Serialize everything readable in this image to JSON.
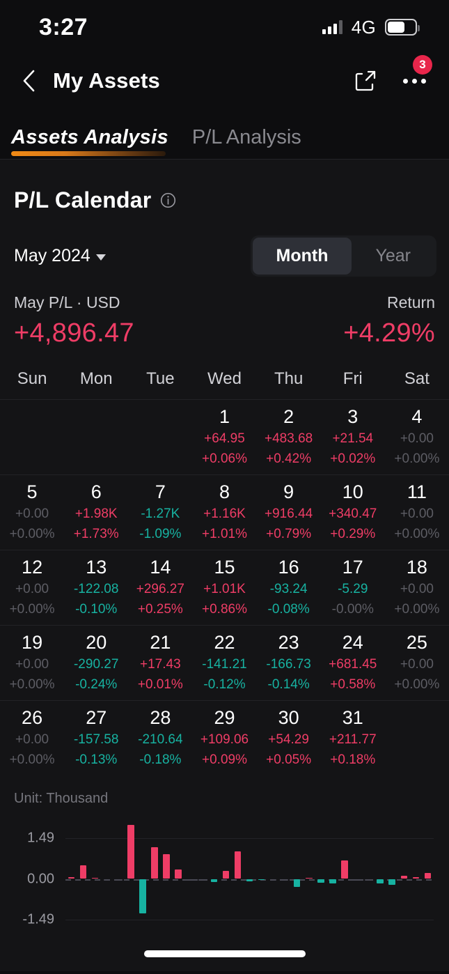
{
  "status_bar": {
    "time": "3:27",
    "network": "4G",
    "battery_level": 62,
    "signal_bars": 4
  },
  "nav": {
    "back_icon": "chevron-left-icon",
    "title": "My Assets",
    "share_icon": "share-external-icon",
    "more_icon": "more-dots-icon",
    "badge_count": "3"
  },
  "tabs": [
    {
      "label": "Assets Analysis",
      "active": true
    },
    {
      "label": "P/L Analysis",
      "active": false
    }
  ],
  "section": {
    "title": "P/L Calendar",
    "info_icon": "info-circle-icon",
    "month_selector": "May 2024",
    "caret_icon": "chevron-down-icon",
    "range_options": [
      {
        "label": "Month",
        "selected": true
      },
      {
        "label": "Year",
        "selected": false
      }
    ]
  },
  "summary": {
    "pl_label": "May P/L · USD",
    "pl_value": "+4,896.47",
    "return_label": "Return",
    "return_value": "+4.29%"
  },
  "colors": {
    "positive": "#ef3d66",
    "negative": "#17b2a1",
    "zero": "#5d5d64",
    "accent_tab": "#f08a16",
    "badge": "#e8264b"
  },
  "calendar": {
    "weekday_headers": [
      "Sun",
      "Mon",
      "Tue",
      "Wed",
      "Thu",
      "Fri",
      "Sat"
    ],
    "weeks": [
      [
        {
          "day": "",
          "amount": "",
          "percent": "",
          "state": "empty"
        },
        {
          "day": "",
          "amount": "",
          "percent": "",
          "state": "empty"
        },
        {
          "day": "",
          "amount": "",
          "percent": "",
          "state": "empty"
        },
        {
          "day": "1",
          "amount": "+64.95",
          "percent": "+0.06%",
          "state": "pos"
        },
        {
          "day": "2",
          "amount": "+483.68",
          "percent": "+0.42%",
          "state": "pos"
        },
        {
          "day": "3",
          "amount": "+21.54",
          "percent": "+0.02%",
          "state": "pos"
        },
        {
          "day": "4",
          "amount": "+0.00",
          "percent": "+0.00%",
          "state": "zero"
        }
      ],
      [
        {
          "day": "5",
          "amount": "+0.00",
          "percent": "+0.00%",
          "state": "zero"
        },
        {
          "day": "6",
          "amount": "+1.98K",
          "percent": "+1.73%",
          "state": "pos"
        },
        {
          "day": "7",
          "amount": "-1.27K",
          "percent": "-1.09%",
          "state": "neg"
        },
        {
          "day": "8",
          "amount": "+1.16K",
          "percent": "+1.01%",
          "state": "pos"
        },
        {
          "day": "9",
          "amount": "+916.44",
          "percent": "+0.79%",
          "state": "pos"
        },
        {
          "day": "10",
          "amount": "+340.47",
          "percent": "+0.29%",
          "state": "pos"
        },
        {
          "day": "11",
          "amount": "+0.00",
          "percent": "+0.00%",
          "state": "zero"
        }
      ],
      [
        {
          "day": "12",
          "amount": "+0.00",
          "percent": "+0.00%",
          "state": "zero"
        },
        {
          "day": "13",
          "amount": "-122.08",
          "percent": "-0.10%",
          "state": "neg"
        },
        {
          "day": "14",
          "amount": "+296.27",
          "percent": "+0.25%",
          "state": "pos"
        },
        {
          "day": "15",
          "amount": "+1.01K",
          "percent": "+0.86%",
          "state": "pos"
        },
        {
          "day": "16",
          "amount": "-93.24",
          "percent": "-0.08%",
          "state": "neg"
        },
        {
          "day": "17",
          "amount": "-5.29",
          "percent": "-0.00%",
          "state": "neg-zeropct"
        },
        {
          "day": "18",
          "amount": "+0.00",
          "percent": "+0.00%",
          "state": "zero"
        }
      ],
      [
        {
          "day": "19",
          "amount": "+0.00",
          "percent": "+0.00%",
          "state": "zero"
        },
        {
          "day": "20",
          "amount": "-290.27",
          "percent": "-0.24%",
          "state": "neg"
        },
        {
          "day": "21",
          "amount": "+17.43",
          "percent": "+0.01%",
          "state": "pos"
        },
        {
          "day": "22",
          "amount": "-141.21",
          "percent": "-0.12%",
          "state": "neg"
        },
        {
          "day": "23",
          "amount": "-166.73",
          "percent": "-0.14%",
          "state": "neg"
        },
        {
          "day": "24",
          "amount": "+681.45",
          "percent": "+0.58%",
          "state": "pos"
        },
        {
          "day": "25",
          "amount": "+0.00",
          "percent": "+0.00%",
          "state": "zero"
        }
      ],
      [
        {
          "day": "26",
          "amount": "+0.00",
          "percent": "+0.00%",
          "state": "zero"
        },
        {
          "day": "27",
          "amount": "-157.58",
          "percent": "-0.13%",
          "state": "neg"
        },
        {
          "day": "28",
          "amount": "-210.64",
          "percent": "-0.18%",
          "state": "neg"
        },
        {
          "day": "29",
          "amount": "+109.06",
          "percent": "+0.09%",
          "state": "pos"
        },
        {
          "day": "30",
          "amount": "+54.29",
          "percent": "+0.05%",
          "state": "pos"
        },
        {
          "day": "31",
          "amount": "+211.77",
          "percent": "+0.18%",
          "state": "pos"
        },
        {
          "day": "",
          "amount": "",
          "percent": "",
          "state": "empty"
        }
      ]
    ]
  },
  "chart_data": {
    "type": "bar",
    "unit_label": "Unit: Thousand",
    "title": "",
    "xlabel": "",
    "ylabel": "",
    "ylim": [
      -1.49,
      1.49
    ],
    "yticks": [
      "1.49",
      "0.00",
      "-1.49"
    ],
    "grid": true,
    "legend": "none",
    "categories": [
      "1",
      "2",
      "3",
      "4",
      "5",
      "6",
      "7",
      "8",
      "9",
      "10",
      "11",
      "12",
      "13",
      "14",
      "15",
      "16",
      "17",
      "18",
      "19",
      "20",
      "21",
      "22",
      "23",
      "24",
      "25",
      "26",
      "27",
      "28",
      "29",
      "30",
      "31"
    ],
    "values": [
      0.065,
      0.484,
      0.022,
      0.0,
      0.0,
      1.98,
      -1.27,
      1.16,
      0.916,
      0.34,
      0.0,
      0.0,
      -0.122,
      0.296,
      1.01,
      -0.093,
      -0.005,
      0.0,
      0.0,
      -0.29,
      0.017,
      -0.141,
      -0.167,
      0.681,
      0.0,
      0.0,
      -0.158,
      -0.211,
      0.109,
      0.054,
      0.212
    ],
    "positive_color": "#ef3d66",
    "negative_color": "#17b2a1"
  }
}
